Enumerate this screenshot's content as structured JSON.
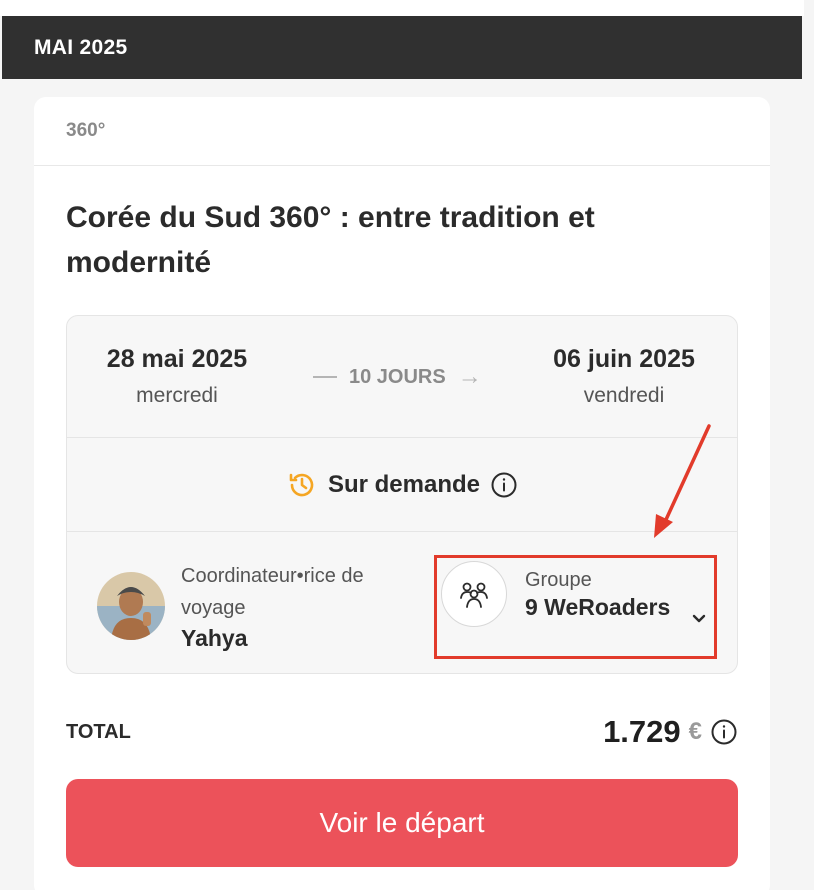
{
  "month_header": "MAI 2025",
  "card": {
    "category": "360°",
    "title": "Corée du Sud 360° : entre tradition et modernité",
    "start_date": "28 mai 2025",
    "start_day": "mercredi",
    "duration": "10 JOURS",
    "end_date": "06 juin 2025",
    "end_day": "vendredi",
    "availability": "Sur demande",
    "coordinator_label": "Coordinateur•rice de voyage",
    "coordinator_name": "Yahya",
    "group_label": "Groupe",
    "group_value": "9 WeRoaders",
    "total_label": "TOTAL",
    "price": "1.729",
    "currency": "€",
    "cta_label": "Voir le départ"
  },
  "icons": {
    "availability": "history-icon",
    "info": "info-icon",
    "group": "people-group-icon",
    "expand": "chevron-down-icon",
    "annotation": "red-arrow-icon"
  },
  "colors": {
    "cta": "#ec525a",
    "header_bar": "#303030",
    "accent_orange": "#f5a623",
    "annotation_red": "#e23b2b"
  }
}
